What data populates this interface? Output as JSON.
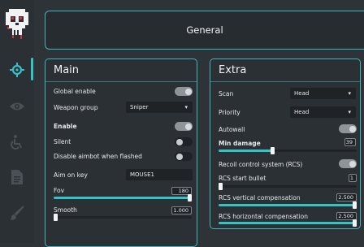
{
  "colors": {
    "accent": "#35c3c6",
    "background": "#2e3337",
    "panel": "#2b3034",
    "field": "#1f2326"
  },
  "sidebar": {
    "items": [
      {
        "icon": "crosshair-icon",
        "active": true
      },
      {
        "icon": "eye-icon",
        "active": false
      },
      {
        "icon": "wheelchair-icon",
        "active": false
      },
      {
        "icon": "document-icon",
        "active": false
      },
      {
        "icon": "paintbrush-icon",
        "active": false
      }
    ]
  },
  "header": {
    "title": "General"
  },
  "main": {
    "title": "Main",
    "global_enable": {
      "label": "Global enable",
      "on": true
    },
    "weapon_group": {
      "label": "Weapon group",
      "value": "Sniper"
    },
    "enable": {
      "label": "Enable",
      "on": true
    },
    "silent": {
      "label": "Silent",
      "on": false
    },
    "disable_flashed": {
      "label": "Disable aimbot when flashed",
      "on": false
    },
    "aim_key": {
      "label": "Aim on key",
      "value": "MOUSE1"
    },
    "fov": {
      "label": "Fov",
      "value": "180",
      "fraction": 1.0
    },
    "smooth": {
      "label": "Smooth",
      "value": "1.000",
      "fraction": 0.0
    }
  },
  "extra": {
    "title": "Extra",
    "scan": {
      "label": "Scan",
      "value": "Head"
    },
    "priority": {
      "label": "Priority",
      "value": "Head"
    },
    "autowall": {
      "label": "Autowall",
      "on": true
    },
    "min_damage": {
      "label": "Min damage",
      "value": "39",
      "fraction": 0.39
    },
    "rcs": {
      "label": "Recoil control system (RCS)",
      "on": true
    },
    "rcs_start": {
      "label": "RCS start bullet",
      "value": "1",
      "fraction": 0.0
    },
    "rcs_vertical": {
      "label": "RCS vertical compensation",
      "value": "2.500",
      "fraction": 1.0
    },
    "rcs_horizontal": {
      "label": "RCS horizontal compensation",
      "value": "2.500",
      "fraction": 1.0
    }
  }
}
